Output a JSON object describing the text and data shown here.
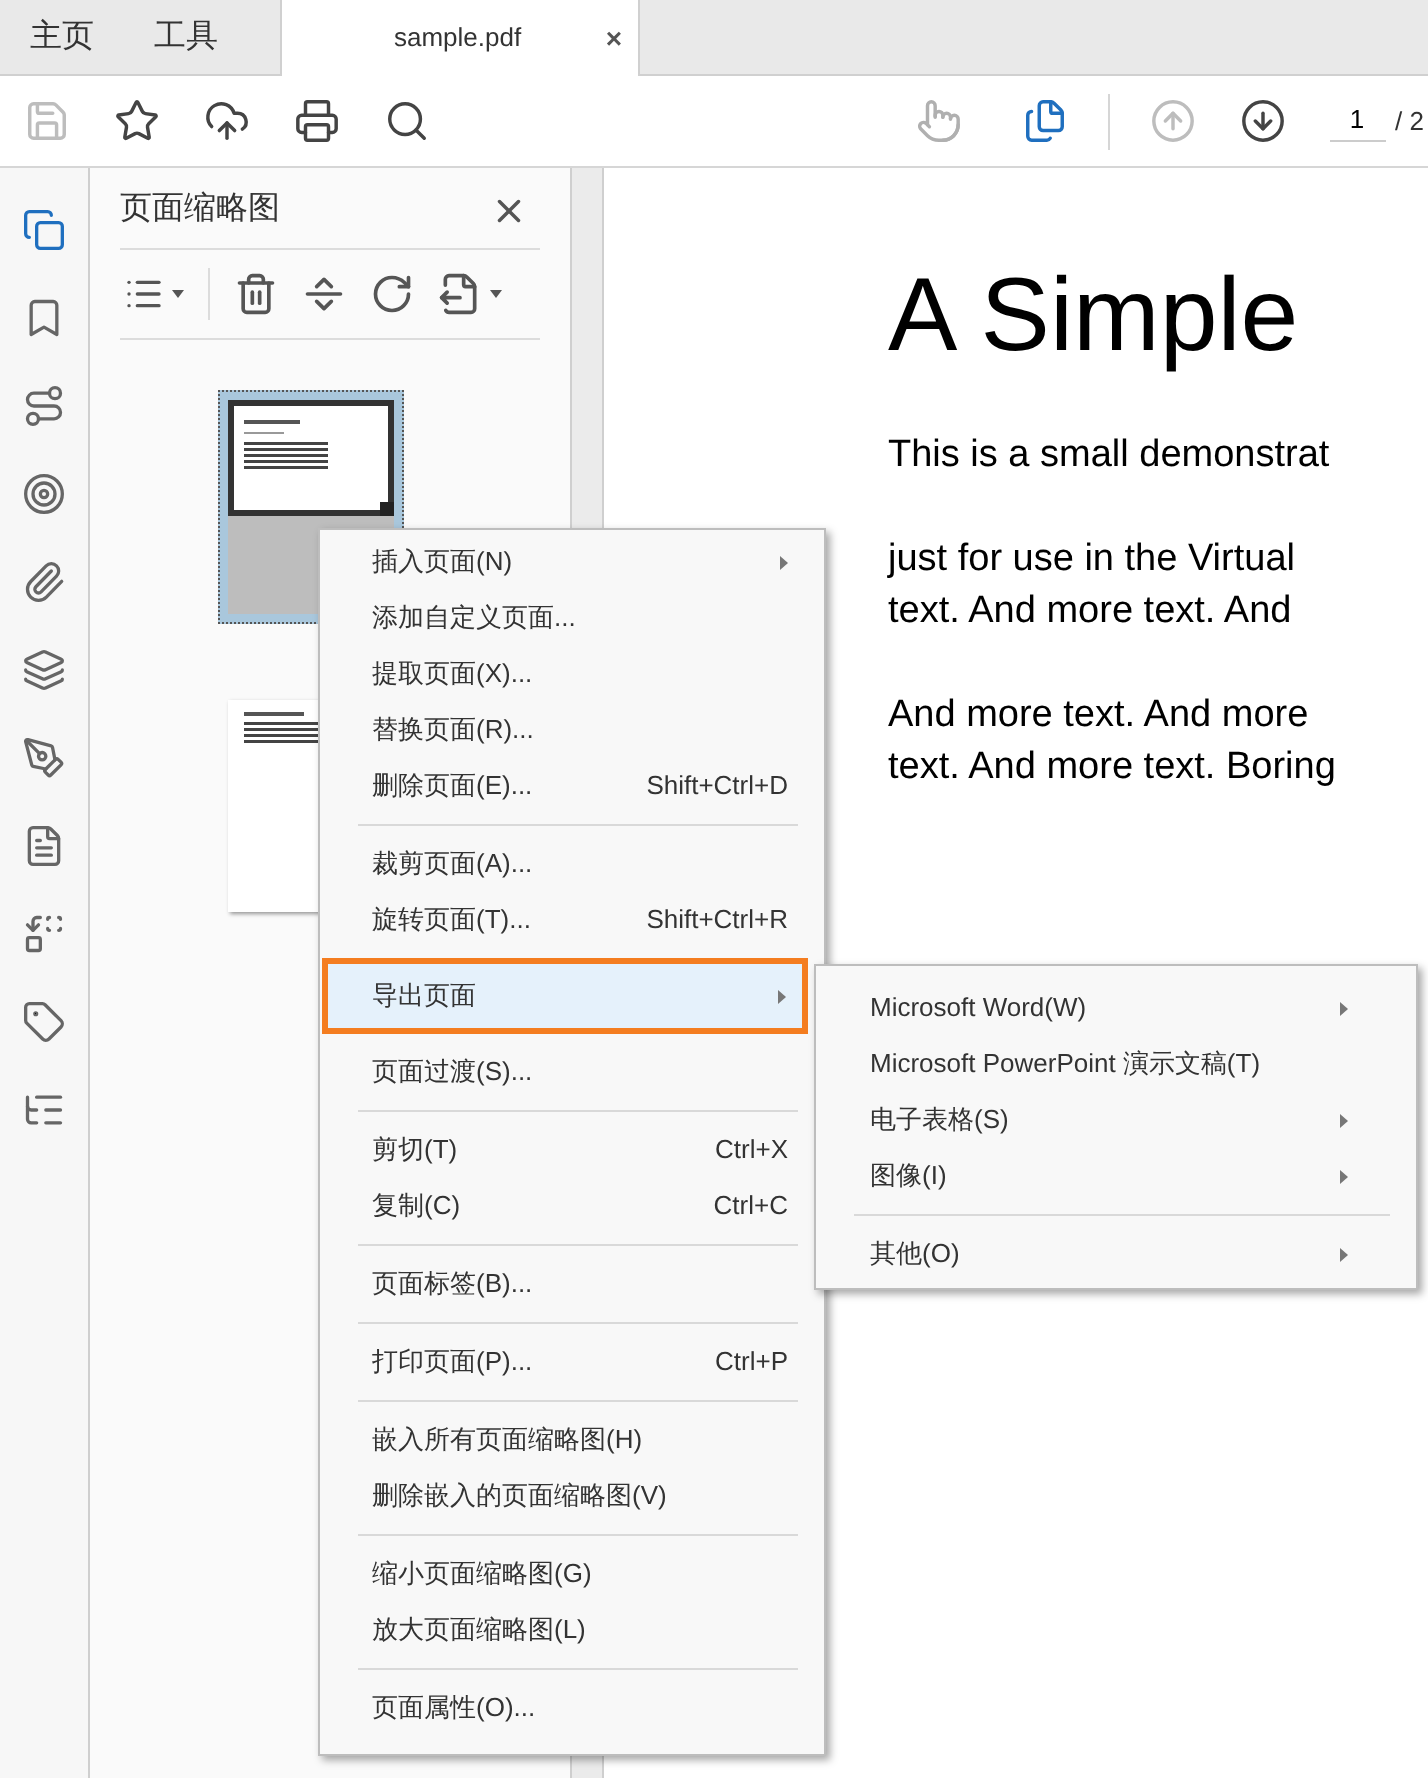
{
  "tabs": [
    {
      "label": "主页",
      "selected": false,
      "kind": "nav"
    },
    {
      "label": "工具",
      "selected": false,
      "kind": "nav"
    },
    {
      "label": "sample.pdf",
      "selected": true,
      "kind": "document",
      "close": "×"
    }
  ],
  "toolbar": {
    "file_buttons": [
      {
        "disabled": true
      },
      {
        "disabled": false
      },
      {
        "disabled": false
      },
      {
        "disabled": false
      },
      {
        "disabled": false
      }
    ],
    "mode_buttons": [
      {
        "selected": false
      },
      {
        "selected": true
      }
    ],
    "nav_buttons": [
      {
        "disabled": true
      },
      {
        "disabled": false
      }
    ],
    "page_field": {
      "value": "1"
    },
    "page_total": "/ 2"
  },
  "rail": [
    {
      "selected": true
    },
    {
      "selected": false
    },
    {
      "selected": false
    },
    {
      "selected": false
    },
    {
      "selected": false
    },
    {
      "selected": false
    },
    {
      "selected": false
    },
    {
      "selected": false
    },
    {
      "selected": false
    },
    {
      "selected": false
    },
    {
      "selected": false
    }
  ],
  "panel": {
    "title": "页面缩略图",
    "thumbnails": [
      {
        "selected": true
      },
      {
        "selected": false
      }
    ]
  },
  "document": {
    "title": "A Simple",
    "paragraphs": [
      [
        "This is a small demonstrat"
      ],
      [
        "just for use in the Virtual",
        "text. And more text. And"
      ],
      [
        "And more text. And more",
        "text. And more text. Boring"
      ]
    ]
  },
  "context_menu": {
    "groups": [
      [
        {
          "label": "插入页面(N)",
          "has_submenu": true,
          "selected": false
        },
        {
          "label": "添加自定义页面...",
          "has_submenu": false,
          "selected": false
        },
        {
          "label": "提取页面(X)...",
          "has_submenu": false,
          "selected": false
        },
        {
          "label": "替换页面(R)...",
          "has_submenu": false,
          "selected": false
        },
        {
          "label": "删除页面(E)...",
          "shortcut": "Shift+Ctrl+D",
          "has_submenu": false,
          "selected": false
        }
      ],
      [
        {
          "label": "裁剪页面(A)...",
          "has_submenu": false,
          "selected": false
        },
        {
          "label": "旋转页面(T)...",
          "shortcut": "Shift+Ctrl+R",
          "has_submenu": false,
          "selected": false
        },
        {
          "label": "导出页面",
          "has_submenu": true,
          "selected": true
        },
        {
          "label": "页面过渡(S)...",
          "has_submenu": false,
          "selected": false
        }
      ],
      [
        {
          "label": "剪切(T)",
          "shortcut": "Ctrl+X",
          "has_submenu": false,
          "selected": false
        },
        {
          "label": "复制(C)",
          "shortcut": "Ctrl+C",
          "has_submenu": false,
          "selected": false
        }
      ],
      [
        {
          "label": "页面标签(B)...",
          "has_submenu": false,
          "selected": false
        }
      ],
      [
        {
          "label": "打印页面(P)...",
          "shortcut": "Ctrl+P",
          "has_submenu": false,
          "selected": false
        }
      ],
      [
        {
          "label": "嵌入所有页面缩略图(H)",
          "has_submenu": false,
          "selected": false
        },
        {
          "label": "删除嵌入的页面缩略图(V)",
          "has_submenu": false,
          "selected": false
        }
      ],
      [
        {
          "label": "缩小页面缩略图(G)",
          "has_submenu": false,
          "selected": false
        },
        {
          "label": "放大页面缩略图(L)",
          "has_submenu": false,
          "selected": false
        }
      ],
      [
        {
          "label": "页面属性(O)...",
          "has_submenu": false,
          "selected": false
        }
      ]
    ]
  },
  "submenu": {
    "groups": [
      [
        {
          "label": "Microsoft Word(W)",
          "has_submenu": true,
          "selected": false
        },
        {
          "label": "Microsoft PowerPoint 演示文稿(T)",
          "has_submenu": false,
          "selected": false
        },
        {
          "label": "电子表格(S)",
          "has_submenu": true,
          "selected": false
        },
        {
          "label": "图像(I)",
          "has_submenu": true,
          "selected": false
        }
      ],
      [
        {
          "label": "其他(O)",
          "has_submenu": true,
          "selected": false
        }
      ]
    ]
  }
}
